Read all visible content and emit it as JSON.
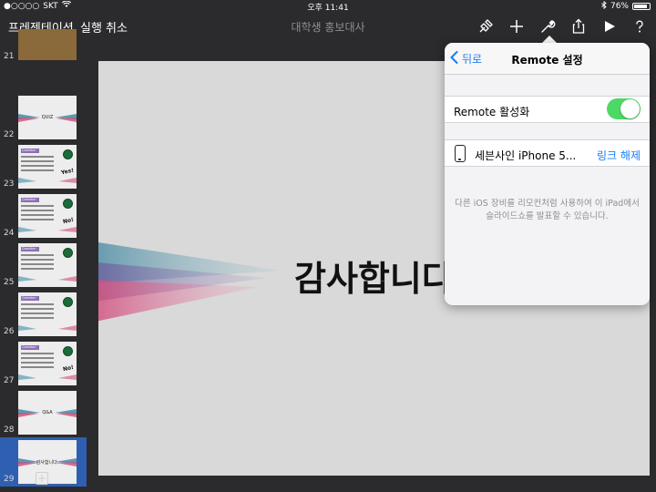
{
  "status_bar": {
    "carrier": "SKT",
    "signal": "●○○○○",
    "time": "오후 11:41",
    "battery": "76%"
  },
  "toolbar": {
    "presentation_label": "프레젠테이션",
    "undo_label": "실행 취소",
    "document_title": "대학생 홍보대사"
  },
  "sidebar": {
    "slides": [
      {
        "number": "21",
        "kind": "image"
      },
      {
        "number": "22",
        "kind": "label",
        "label": "QUIZ"
      },
      {
        "number": "23",
        "kind": "question",
        "tag": "Question",
        "stamp": "Yes!"
      },
      {
        "number": "24",
        "kind": "question",
        "tag": "Question",
        "stamp": "No!"
      },
      {
        "number": "25",
        "kind": "question",
        "tag": "Question",
        "stamp": ""
      },
      {
        "number": "26",
        "kind": "question",
        "tag": "Question",
        "stamp": ""
      },
      {
        "number": "27",
        "kind": "question",
        "tag": "Question",
        "stamp": "No!"
      },
      {
        "number": "28",
        "kind": "label",
        "label": "Q&A"
      },
      {
        "number": "29",
        "kind": "label",
        "label": "감사합니다."
      }
    ],
    "selected_slide": "29",
    "add_label": "+"
  },
  "slide": {
    "title": "감사합니다"
  },
  "popover": {
    "back_label": "뒤로",
    "title": "Remote 설정",
    "enable_label": "Remote 활성화",
    "enabled": true,
    "device_name": "세븐사인 iPhone 5...",
    "unlink_label": "링크 해제",
    "footnote": "다른 iOS 장비를 리모컨처럼 사용하여 이 iPad에서 슬라이드쇼를 발표할 수 있습니다."
  },
  "colors": {
    "accent": "#1a7cf5",
    "toggle_on": "#4cd964",
    "selected_row": "#2f5fb0",
    "question_tag": "#8a6fb5"
  }
}
